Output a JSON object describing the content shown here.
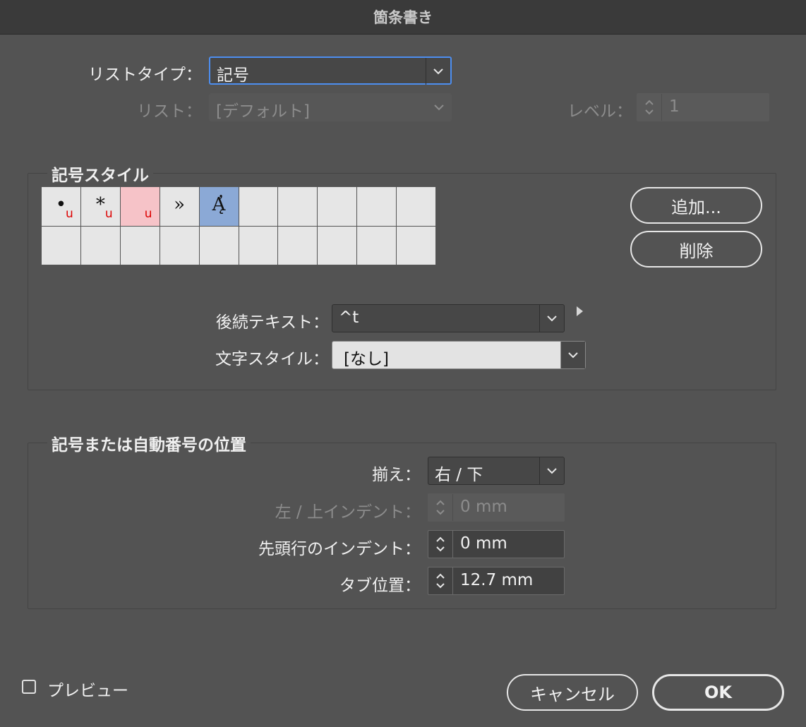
{
  "window": {
    "title": "箇条書き"
  },
  "list_type": {
    "label": "リストタイプ：",
    "value": "記号"
  },
  "list": {
    "label": "リスト：",
    "value": "[デフォルト]"
  },
  "level": {
    "label": "レベル：",
    "value": "1"
  },
  "bullet_style": {
    "title": "記号スタイル",
    "glyphs": [
      {
        "char": "•",
        "mark": "u",
        "state": "normal"
      },
      {
        "char": "*",
        "mark": "u",
        "state": "normal"
      },
      {
        "char": "",
        "mark": "u",
        "state": "highlighted"
      },
      {
        "char": "»",
        "mark": "",
        "state": "normal"
      },
      {
        "char": "Ą̓",
        "mark": "",
        "state": "selected"
      }
    ],
    "add_button": "追加...",
    "delete_button": "削除",
    "following_text": {
      "label": "後続テキスト：",
      "value": "^t"
    },
    "char_style": {
      "label": "文字スタイル：",
      "value": "[なし]"
    }
  },
  "position": {
    "title": "記号または自動番号の位置",
    "alignment": {
      "label": "揃え：",
      "value": "右 / 下"
    },
    "left_indent": {
      "label": "左 / 上インデント：",
      "value": "0 mm"
    },
    "first_line_indent": {
      "label": "先頭行のインデント：",
      "value": "0 mm"
    },
    "tab_position": {
      "label": "タブ位置：",
      "value": "12.7 mm"
    }
  },
  "preview": {
    "label": "プレビュー",
    "checked": false
  },
  "buttons": {
    "cancel": "キャンセル",
    "ok": "OK"
  },
  "icons": {
    "dropdown": "chevron-down-icon",
    "stepper": "stepper-icon",
    "flyout": "triangle-right-icon",
    "checkbox": "checkbox-icon"
  },
  "colors": {
    "background": "#535353",
    "titlebar": "#3a3a3a",
    "focus": "#4d8ef0",
    "selected_cell": "#8ba9d6",
    "highlight_cell": "#f6c3c8",
    "mark_red": "#dd0000"
  }
}
